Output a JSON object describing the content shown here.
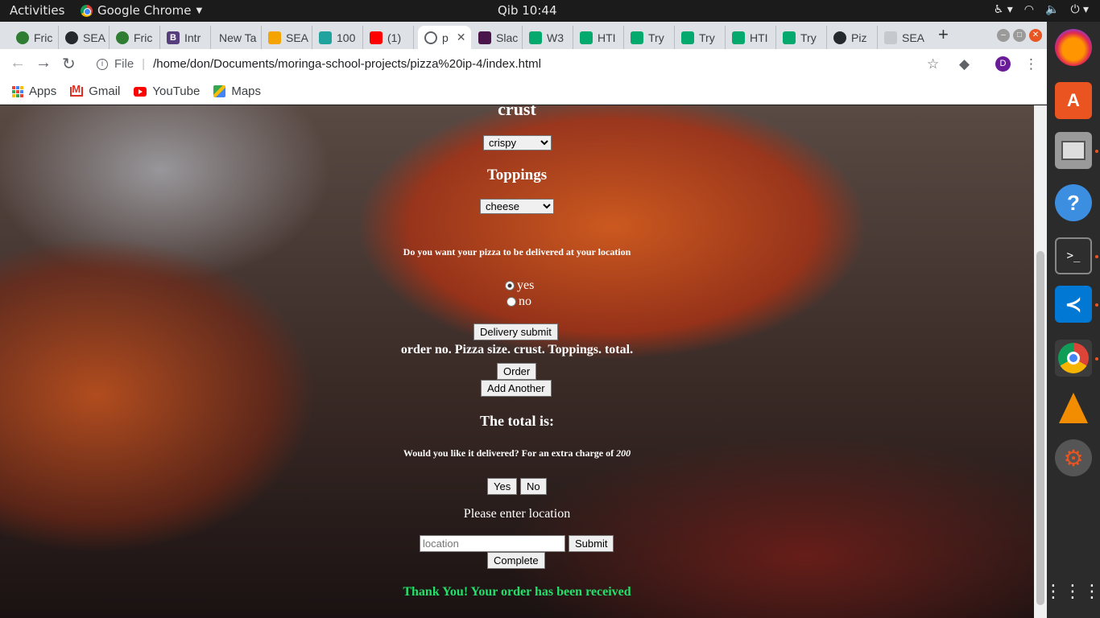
{
  "topbar": {
    "activities": "Activities",
    "app_name": "Google Chrome",
    "clock": "Qib 10:44"
  },
  "tabs": [
    {
      "label": "Fric",
      "fav_color": "#2e7d32"
    },
    {
      "label": "SEA",
      "fav_color": "#24292e"
    },
    {
      "label": "Fric",
      "fav_color": "#2e7d32"
    },
    {
      "label": "Intr",
      "fav_color": "#563d7c"
    },
    {
      "label": "New Ta",
      "fav_color": "#dee1e6"
    },
    {
      "label": "SEA",
      "fav_color": "#f4a300"
    },
    {
      "label": "100",
      "fav_color": "#20a39e"
    },
    {
      "label": "(1)",
      "fav_color": "#ff0000"
    },
    {
      "label": "p",
      "fav_color": "#5f6368",
      "active": true
    },
    {
      "label": "Slac",
      "fav_color": "#4a154b"
    },
    {
      "label": "W3",
      "fav_color": "#04aa6d"
    },
    {
      "label": "HTI",
      "fav_color": "#04aa6d"
    },
    {
      "label": "Try",
      "fav_color": "#04aa6d"
    },
    {
      "label": "Try",
      "fav_color": "#04aa6d"
    },
    {
      "label": "HTI",
      "fav_color": "#04aa6d"
    },
    {
      "label": "Try",
      "fav_color": "#04aa6d"
    },
    {
      "label": "Piz",
      "fav_color": "#24292e"
    },
    {
      "label": "SEA",
      "fav_color": "#dee1e6"
    }
  ],
  "address": {
    "scheme_label": "File",
    "url": "/home/don/Documents/moringa-school-projects/pizza%20ip-4/index.html",
    "profile_initial": "D"
  },
  "bookmarks": {
    "apps": "Apps",
    "gmail": "Gmail",
    "youtube": "YouTube",
    "maps": "Maps"
  },
  "page": {
    "crust_heading": "crust",
    "crust_selected": "crispy",
    "toppings_heading": "Toppings",
    "toppings_selected": "cheese",
    "delivery_question": "Do you want your pizza to be delivered at your location",
    "radio_yes": "yes",
    "radio_no": "no",
    "delivery_submit": "Delivery submit",
    "order_header": "order no. Pizza size. crust. Toppings. total.",
    "order_button": "Order",
    "add_another_button": "Add Another",
    "total_heading": "The total is:",
    "delivered_question": "Would you like it delivered? For an extra charge of",
    "delivery_charge": "200",
    "yes_button": "Yes",
    "no_button": "No",
    "enter_location": "Please enter location",
    "location_placeholder": "location",
    "submit_button": "Submit",
    "complete_button": "Complete",
    "thank_you": "Thank You! Your order has been received",
    "thank_you_color": "#22e06a"
  },
  "dock": [
    "firefox-icon",
    "software-center-icon",
    "files-icon",
    "help-icon",
    "terminal-icon",
    "vscode-icon",
    "chrome-icon",
    "vlc-icon",
    "settings-icon",
    "show-apps-icon"
  ]
}
